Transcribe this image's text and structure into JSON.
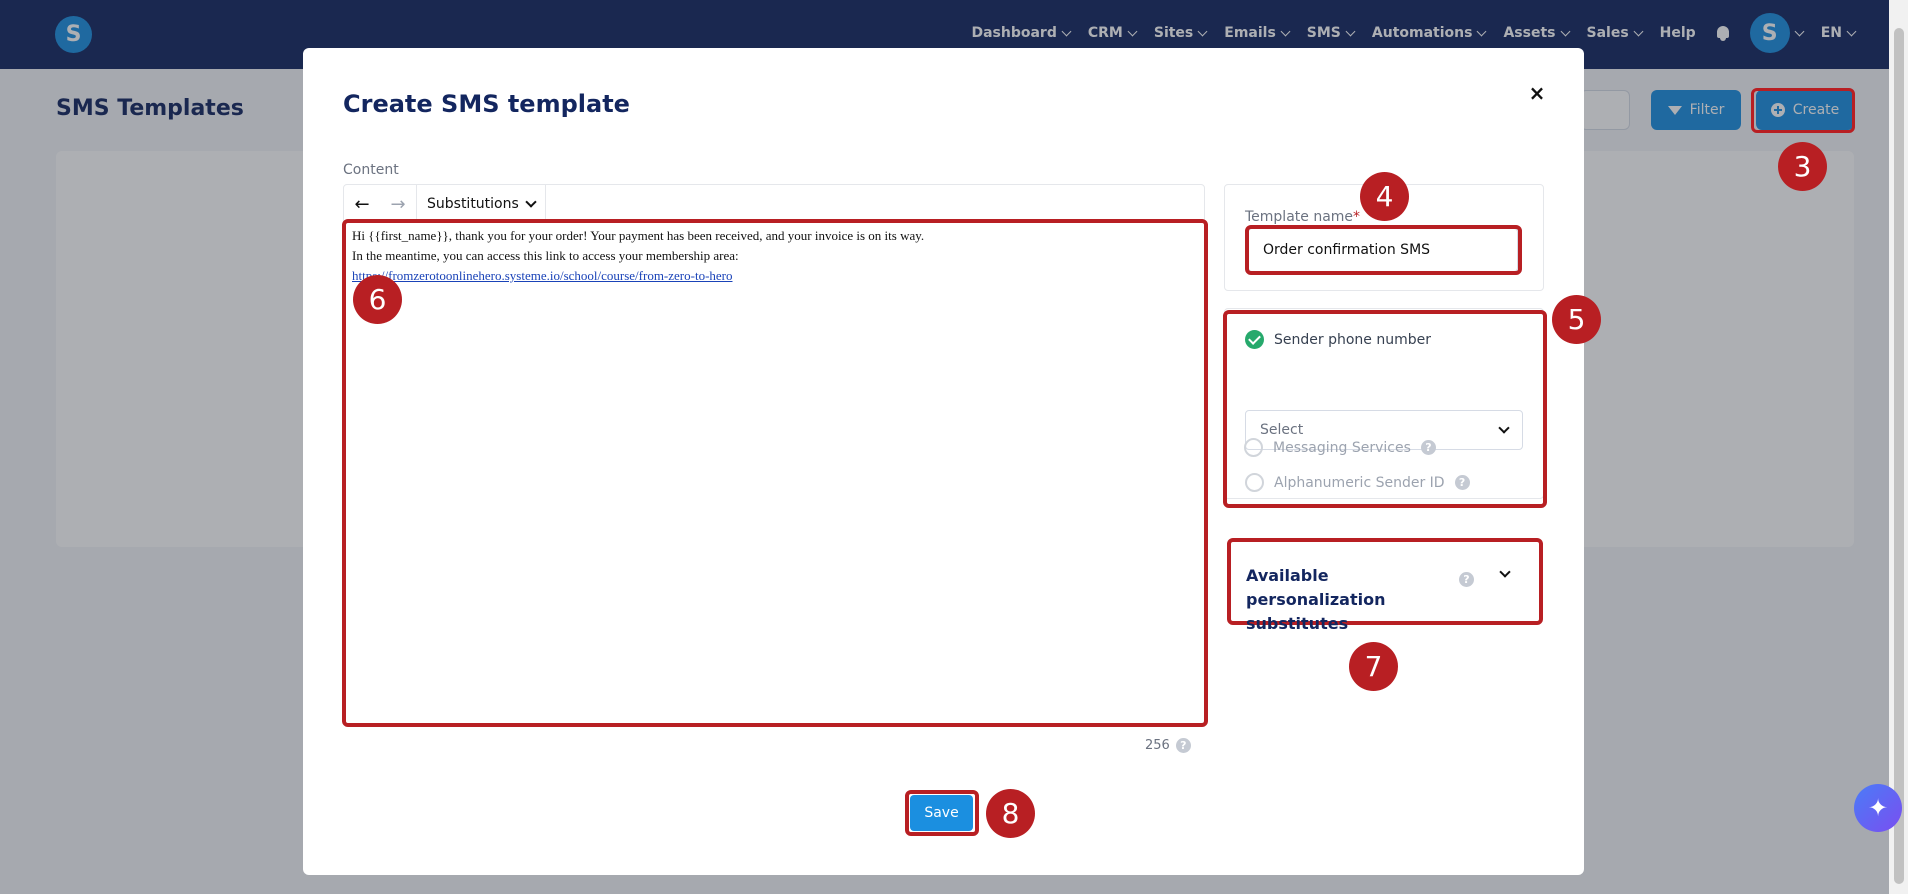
{
  "nav": {
    "logo": "S",
    "items": [
      "Dashboard",
      "CRM",
      "Sites",
      "Emails",
      "SMS",
      "Automations",
      "Assets",
      "Sales"
    ],
    "help": "Help",
    "avatar": "S",
    "language": "EN"
  },
  "page": {
    "title": "SMS Templates",
    "filter_label": "Filter",
    "create_label": "Create"
  },
  "modal": {
    "title": "Create SMS template",
    "close": "×",
    "content_label": "Content",
    "substitutions_label": "Substitutions",
    "editor_lines": [
      "Hi {{first_name}}, thank you for your order! Your payment has been received, and your invoice is on its way.",
      "In the meantime, you can access this link to access your membership area:"
    ],
    "editor_link": "https://fromzerotoonlinehero.systeme.io/school/course/from-zero-to-hero",
    "char_count": "256",
    "template_name_label": "Template name",
    "required_mark": "*",
    "template_name_value": "Order confirmation SMS",
    "sender_phone_label": "Sender phone number",
    "select_placeholder": "Select",
    "alphanumeric_label": "Alphanumeric Sender ID",
    "messaging_services_label": "Messaging Services",
    "personalization_title": "Available personalization substitutes",
    "save_label": "Save"
  },
  "markers": [
    "3",
    "4",
    "5",
    "6",
    "7",
    "8"
  ],
  "colors": {
    "nav_bg": "#13265f",
    "primary": "#1b8fe0",
    "highlight": "#b81f23",
    "success": "#26a96c"
  }
}
